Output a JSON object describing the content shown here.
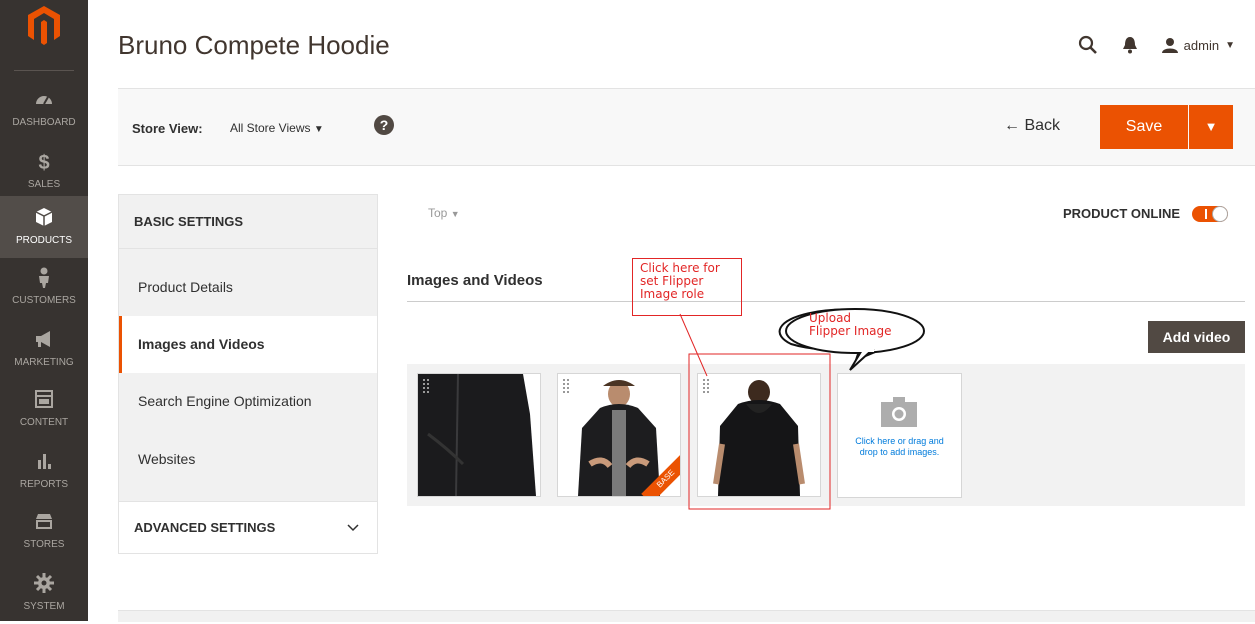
{
  "app": {
    "logo_icon": "magento-logo-icon",
    "accent_color": "#eb5202"
  },
  "nav": [
    {
      "label": "DASHBOARD",
      "icon": "dashboard-icon"
    },
    {
      "label": "SALES",
      "icon": "dollar-icon"
    },
    {
      "label": "PRODUCTS",
      "icon": "cube-icon",
      "active": true
    },
    {
      "label": "CUSTOMERS",
      "icon": "person-icon"
    },
    {
      "label": "MARKETING",
      "icon": "megaphone-icon"
    },
    {
      "label": "CONTENT",
      "icon": "layout-icon"
    },
    {
      "label": "REPORTS",
      "icon": "bar-chart-icon"
    },
    {
      "label": "STORES",
      "icon": "store-icon"
    },
    {
      "label": "SYSTEM",
      "icon": "gear-icon"
    }
  ],
  "header": {
    "title": "Bruno Compete Hoodie",
    "user": "admin"
  },
  "actions": {
    "store_label": "Store View:",
    "store_value": "All Store Views",
    "help": "?",
    "back": "← Back",
    "save": "Save"
  },
  "panel": {
    "basic_title": "BASIC SETTINGS",
    "items": [
      "Product Details",
      "Images and Videos",
      "Search Engine Optimization",
      "Websites"
    ],
    "selected": "Images and Videos",
    "advanced_title": "ADVANCED SETTINGS"
  },
  "main": {
    "scope": "Top",
    "product_online": "PRODUCT ONLINE",
    "online": true,
    "section_title": "Images and Videos",
    "add_video": "Add video",
    "base_badge": "BASE",
    "upload_text": "Click here or drag and drop to add images."
  },
  "annotations": {
    "role_note": [
      "Click here for",
      "set Flipper",
      "Image role"
    ],
    "upload_note": [
      "Upload",
      "Flipper Image"
    ],
    "color": "#e22626"
  }
}
